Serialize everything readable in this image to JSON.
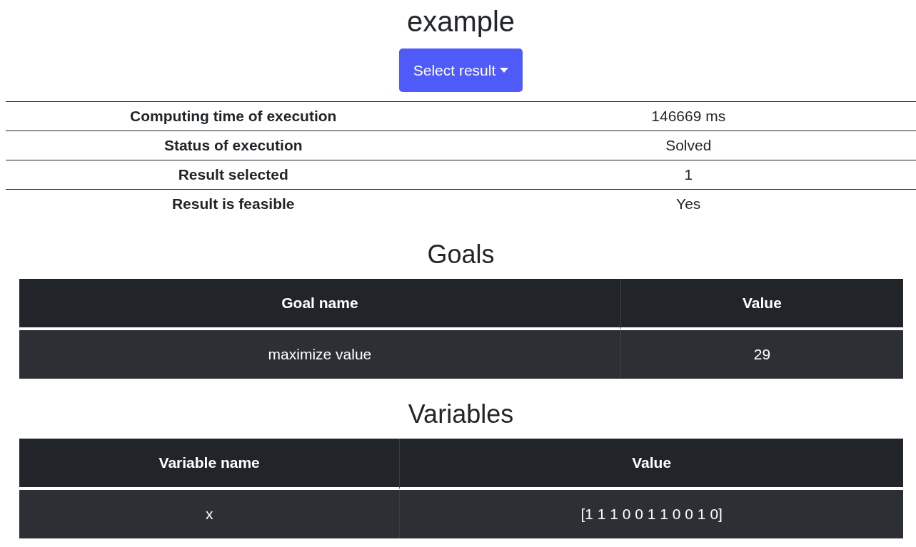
{
  "title": "example",
  "select_button": {
    "label": "Select result"
  },
  "summary": [
    {
      "label": "Computing time of execution",
      "value": "146669 ms"
    },
    {
      "label": "Status of execution",
      "value": "Solved"
    },
    {
      "label": "Result selected",
      "value": "1"
    },
    {
      "label": "Result is feasible",
      "value": "Yes"
    }
  ],
  "goals": {
    "heading": "Goals",
    "columns": [
      "Goal name",
      "Value"
    ],
    "rows": [
      [
        "maximize value",
        "29"
      ]
    ]
  },
  "variables": {
    "heading": "Variables",
    "columns": [
      "Variable name",
      "Value"
    ],
    "rows": [
      [
        "x",
        "[1 1 1 0 0 1 1 0 0 1 0]"
      ]
    ]
  }
}
